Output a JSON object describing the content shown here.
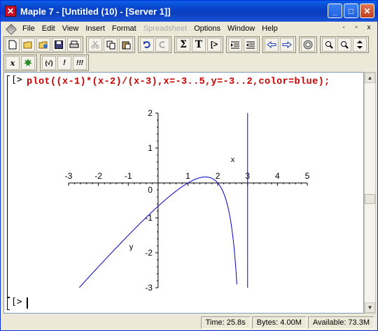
{
  "window": {
    "title": "Maple 7  - [Untitled (10) - [Server 1]]",
    "app_icon": "maple-x-icon",
    "buttons": {
      "minimize": "_",
      "maximize": "□",
      "close": "✕"
    }
  },
  "menubar": {
    "items": [
      "File",
      "Edit",
      "View",
      "Insert",
      "Format",
      "Spreadsheet",
      "Options",
      "Window",
      "Help"
    ],
    "disabled": [
      "Spreadsheet"
    ],
    "doc_buttons": {
      "minimize": "-",
      "restore": "▫",
      "close": "x"
    }
  },
  "toolbar1": {
    "icons": [
      "new-icon",
      "open-icon",
      "open-url-icon",
      "save-icon",
      "print-icon",
      "cut-icon",
      "copy-icon",
      "paste-icon",
      "undo-icon",
      "redo-icon",
      "sigma-icon",
      "text-icon",
      "prompt-icon",
      "indent-icon",
      "outdent-icon",
      "back-icon",
      "forward-icon",
      "stop-icon",
      "zoom-in-icon",
      "zoom-out-icon",
      "expand-icon"
    ],
    "glyphs": {
      "sigma": "Σ",
      "text": "T",
      "prompt": "[>"
    }
  },
  "toolbar2": {
    "icons": [
      "math-x-icon",
      "maple-leaf-icon",
      "check-icon",
      "exclaim-icon",
      "exclaim-all-icon"
    ],
    "glyphs": {
      "math": "x",
      "check": "(√)",
      "exclaim": "!",
      "exclaim_all": "!!!"
    }
  },
  "worksheet": {
    "prompt": "[>",
    "command": "plot((x-1)*(x-2)/(x-3),x=-3..5,y=-3..2,color=blue);",
    "empty_prompt": "[>"
  },
  "chart_data": {
    "type": "line",
    "function": "(x-1)*(x-2)/(x-3)",
    "x_range": [
      -3,
      5
    ],
    "y_range": [
      -3,
      2
    ],
    "xlim": [
      -3,
      5
    ],
    "ylim": [
      -3,
      2
    ],
    "x_ticks": [
      -3,
      -2,
      -1,
      1,
      2,
      3,
      4,
      5
    ],
    "y_ticks": [
      -3,
      -2,
      -1,
      1,
      2
    ],
    "origin_label": "0",
    "xlabel": "x",
    "ylabel": "y",
    "color": "#0000cc",
    "asymptote_x": 3,
    "grid": false
  },
  "statusbar": {
    "time": "Time: 25.8s",
    "bytes": "Bytes: 4.00M",
    "available": "Available: 73.3M"
  }
}
